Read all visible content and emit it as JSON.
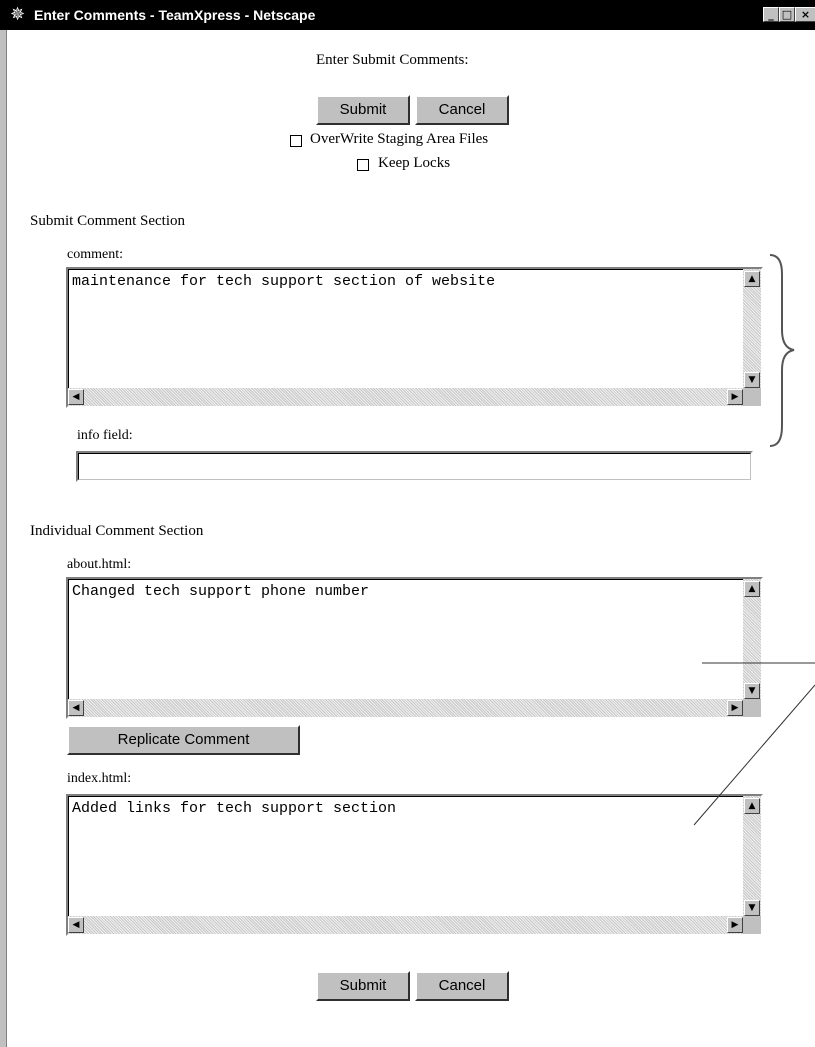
{
  "window": {
    "title": "Enter Comments - TeamXpress - Netscape",
    "app_icon": "netscape-icon",
    "controls": [
      "minimize-icon",
      "maximize-icon",
      "close-icon"
    ]
  },
  "header": {
    "heading": "Enter Submit Comments:",
    "submit_label": "Submit",
    "cancel_label": "Cancel",
    "overwrite_label": "OverWrite Staging Area Files",
    "overwrite_checked": false,
    "keep_locks_label": "Keep Locks",
    "keep_locks_checked": false
  },
  "submit_section": {
    "title": "Submit Comment Section",
    "comment_label": "comment:",
    "comment_value": "maintenance for tech support section of website",
    "info_label": "info field:",
    "info_value": ""
  },
  "individual_section": {
    "title": "Individual Comment Section",
    "files": [
      {
        "label": "about.html:",
        "value": "Changed tech support phone number"
      },
      {
        "label": "index.html:",
        "value": "Added links for tech support section"
      }
    ],
    "replicate_label": "Replicate Comment"
  },
  "footer": {
    "submit_label": "Submit",
    "cancel_label": "Cancel"
  }
}
